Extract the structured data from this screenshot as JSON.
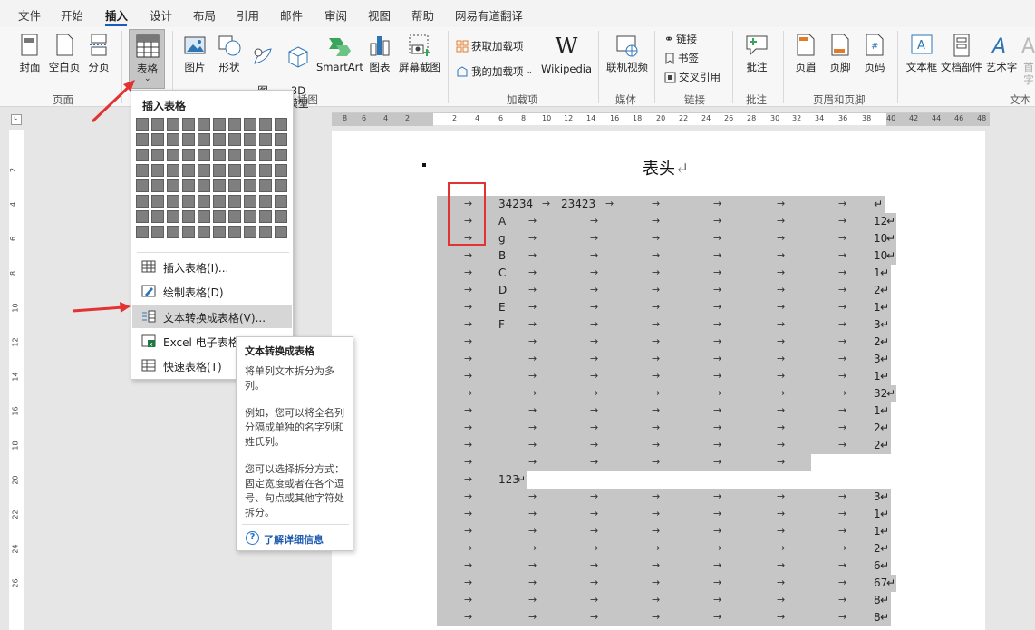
{
  "menu": {
    "tabs": [
      "文件",
      "开始",
      "插入",
      "设计",
      "布局",
      "引用",
      "邮件",
      "审阅",
      "视图",
      "帮助",
      "网易有道翻译"
    ],
    "active": "插入"
  },
  "ribbon": {
    "cover": "封面",
    "blank": "空白页",
    "pagebreak": "分页",
    "table": "表格",
    "picture": "图片",
    "shapes": "形状",
    "icons_label": "图\n标",
    "model3d": "3D\n模型",
    "smartart": "SmartArt",
    "chart": "图表",
    "screenshot": "屏幕截图",
    "get_addins": "获取加载项",
    "my_addins": "我的加载项",
    "wikipedia": "Wikipedia",
    "online_video": "联机视频",
    "link": "链接",
    "bookmark": "书签",
    "crossref": "交叉引用",
    "comment": "批注",
    "header": "页眉",
    "footer": "页脚",
    "pagenum": "页码",
    "textbox": "文本框",
    "docparts": "文档部件",
    "wordart": "艺术字",
    "dropcap": "首字",
    "groups": {
      "pages": "页面",
      "illustrations": "插图",
      "addins": "加载项",
      "media": "媒体",
      "links": "链接",
      "comments": "批注",
      "headerfooter": "页眉和页脚",
      "text": "文本"
    }
  },
  "dropdown": {
    "title": "插入表格",
    "items": [
      "插入表格(I)...",
      "绘制表格(D)",
      "文本转换成表格(V)...",
      "Excel 电子表格(X)",
      "快速表格(T)"
    ]
  },
  "tooltip": {
    "title": "文本转换成表格",
    "p1": "将单列文本拆分为多列。",
    "p2": "例如，您可以将全名列分隔成单独的名字列和姓氏列。",
    "p3": "您可以选择拆分方式：固定宽度或者在各个逗号、句点或其他字符处拆分。",
    "link": "了解详细信息"
  },
  "ruler": {
    "h": [
      "8",
      "6",
      "4",
      "2",
      "2",
      "4",
      "6",
      "8",
      "10",
      "12",
      "14",
      "16",
      "18",
      "20",
      "22",
      "24",
      "26",
      "28",
      "30",
      "32",
      "34",
      "36",
      "38",
      "40",
      "42",
      "44",
      "46",
      "48"
    ],
    "v": [
      "2",
      "4",
      "6",
      "8",
      "10",
      "12",
      "14",
      "16",
      "18",
      "20",
      "22",
      "24",
      "26"
    ]
  },
  "document": {
    "title": "表头",
    "rows": [
      {
        "c1": "34234",
        "c2": "23423",
        "end": ""
      },
      {
        "c1": "A",
        "c2": "",
        "end": "12"
      },
      {
        "c1": "g",
        "c2": "",
        "end": "10"
      },
      {
        "c1": "B",
        "c2": "",
        "end": "10"
      },
      {
        "c1": "C",
        "c2": "",
        "end": "1"
      },
      {
        "c1": "D",
        "c2": "",
        "end": "2"
      },
      {
        "c1": "E",
        "c2": "",
        "end": "1"
      },
      {
        "c1": "F",
        "c2": "",
        "end": "3"
      },
      {
        "c1": "",
        "c2": "",
        "end": "2"
      },
      {
        "c1": "",
        "c2": "",
        "end": "3"
      },
      {
        "c1": "",
        "c2": "",
        "end": "1"
      },
      {
        "c1": "",
        "c2": "",
        "end": "32"
      },
      {
        "c1": "",
        "c2": "",
        "end": "1"
      },
      {
        "c1": "",
        "c2": "",
        "end": "2"
      },
      {
        "c1": "",
        "c2": "",
        "end": "2"
      },
      {
        "c1": "",
        "c2": "",
        "end": ""
      },
      {
        "c1": "123",
        "c2": "",
        "end": ""
      },
      {
        "c1": "",
        "c2": "",
        "end": "3"
      },
      {
        "c1": "",
        "c2": "",
        "end": "1"
      },
      {
        "c1": "",
        "c2": "",
        "end": "1"
      },
      {
        "c1": "",
        "c2": "",
        "end": "2"
      },
      {
        "c1": "",
        "c2": "",
        "end": "6"
      },
      {
        "c1": "",
        "c2": "",
        "end": "67"
      },
      {
        "c1": "",
        "c2": "",
        "end": "8"
      },
      {
        "c1": "",
        "c2": "",
        "end": "8"
      }
    ]
  },
  "colors": {
    "accent": "#185abd",
    "highlight": "#c6c6c6",
    "annotation": "#e23232"
  }
}
